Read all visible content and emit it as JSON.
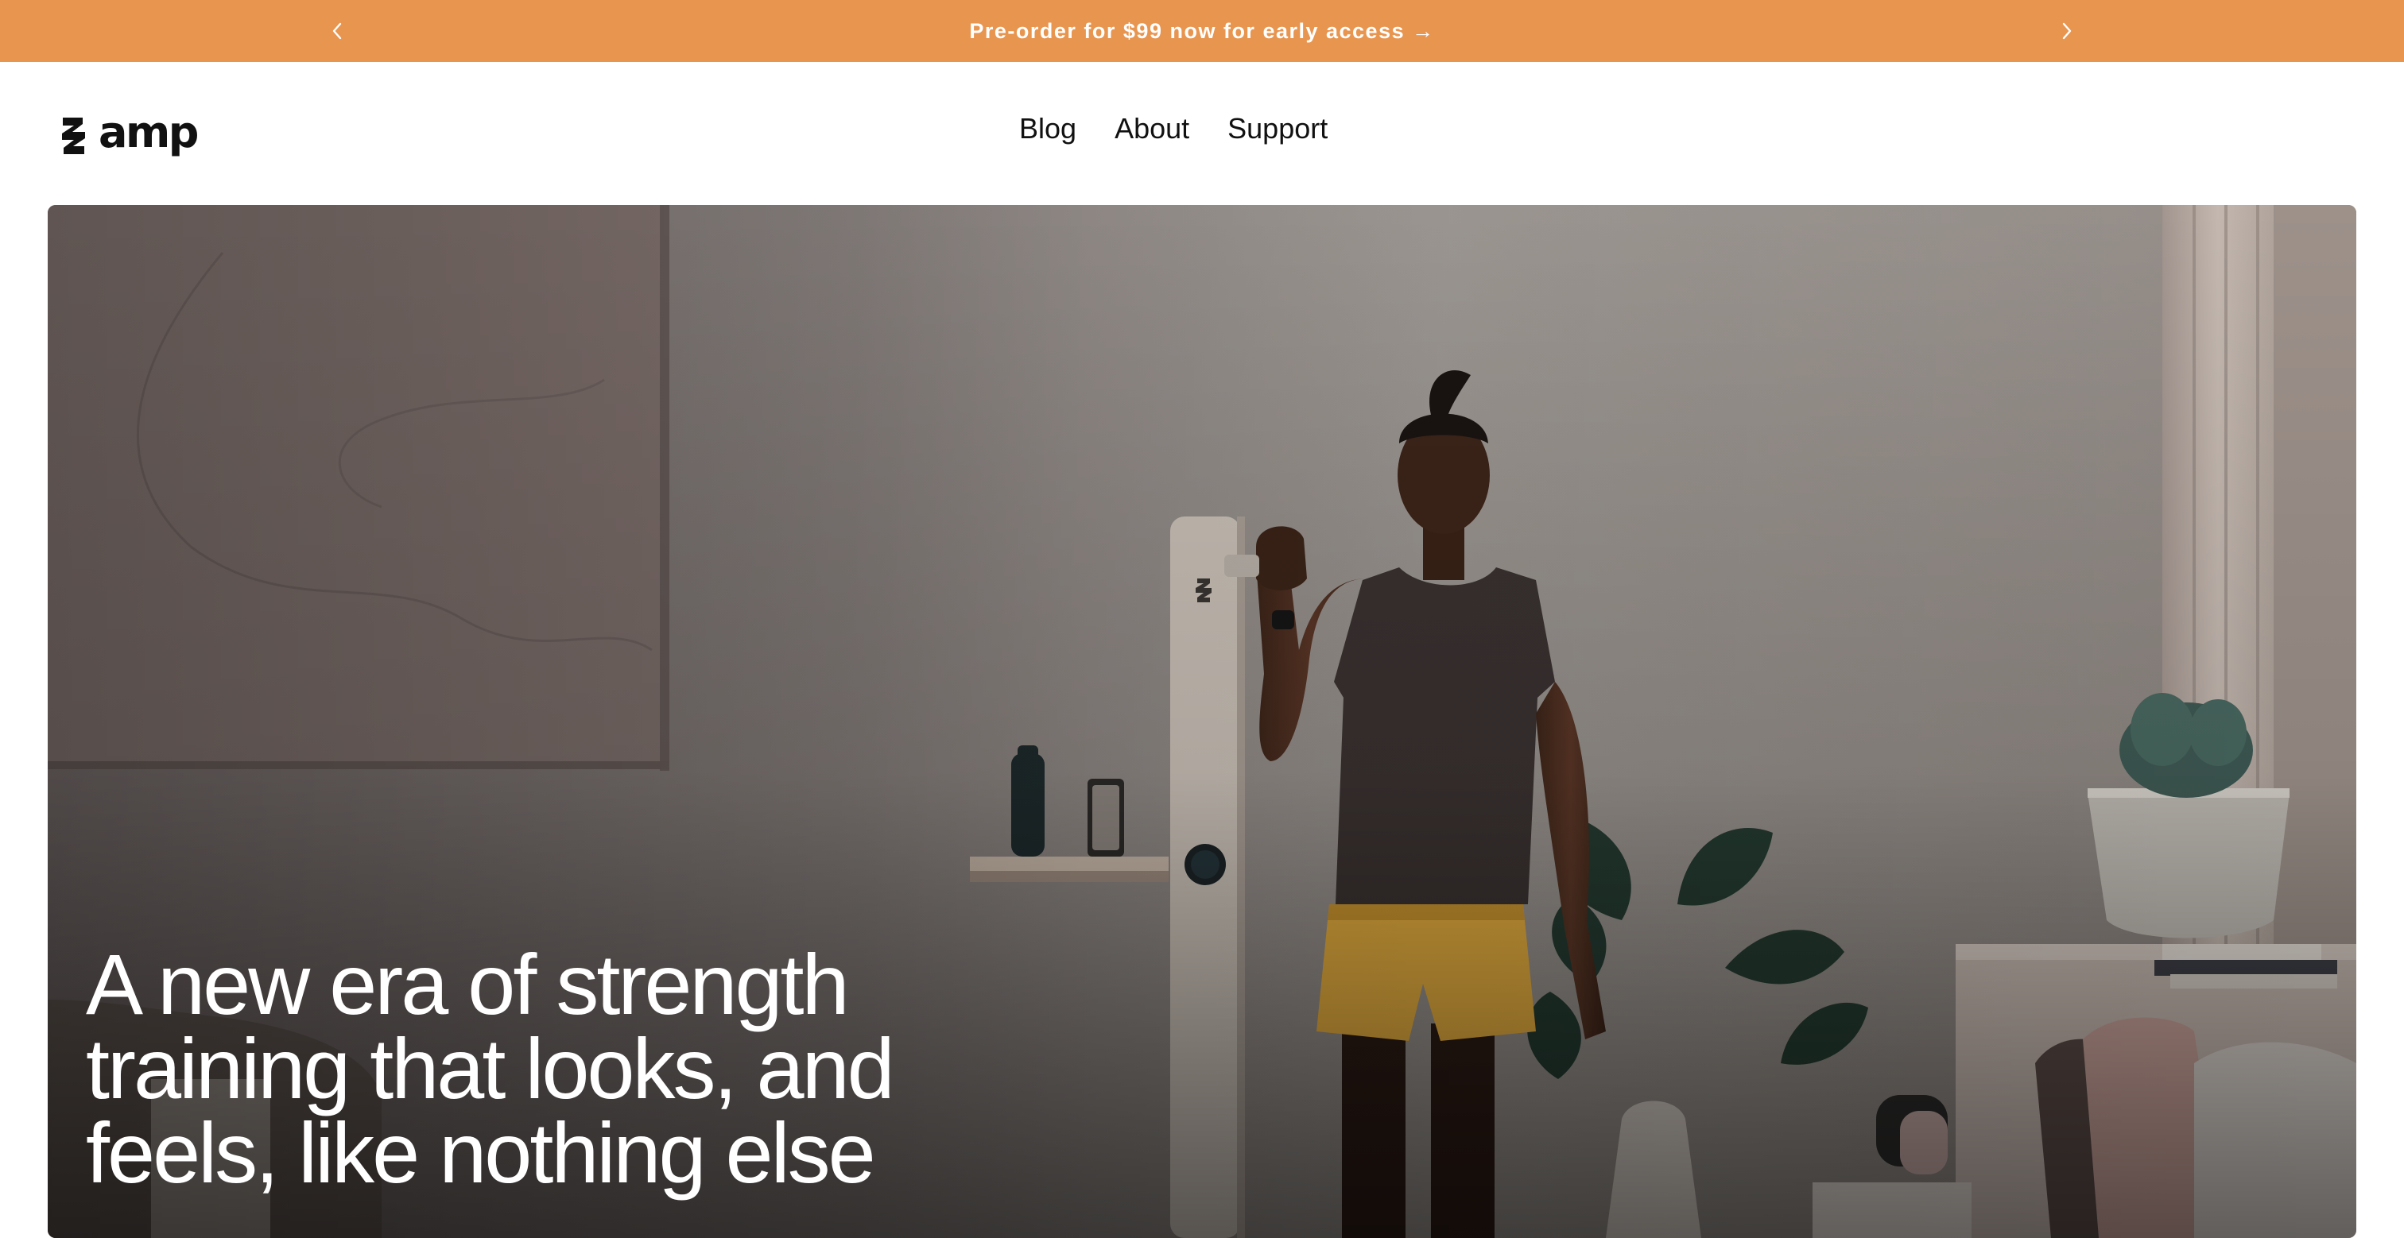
{
  "colors": {
    "announce_bg": "#E8954F",
    "announce_text": "#FFFFFF",
    "nav_text": "#111111",
    "hero_text": "#FFFFFF",
    "shorts": "#E3AC3E"
  },
  "announcement": {
    "text": "Pre-order for $99 now for early access →",
    "prev_icon": "chevron-left-icon",
    "next_icon": "chevron-right-icon"
  },
  "header": {
    "logo": {
      "icon": "amp-logo-mark-icon",
      "wordmark": "amp"
    },
    "nav": [
      {
        "label": "Blog"
      },
      {
        "label": "About"
      },
      {
        "label": "Support"
      }
    ]
  },
  "hero": {
    "headline_lines": [
      "A new era of strength",
      "training that looks, and",
      "feels, like nothing else"
    ]
  }
}
